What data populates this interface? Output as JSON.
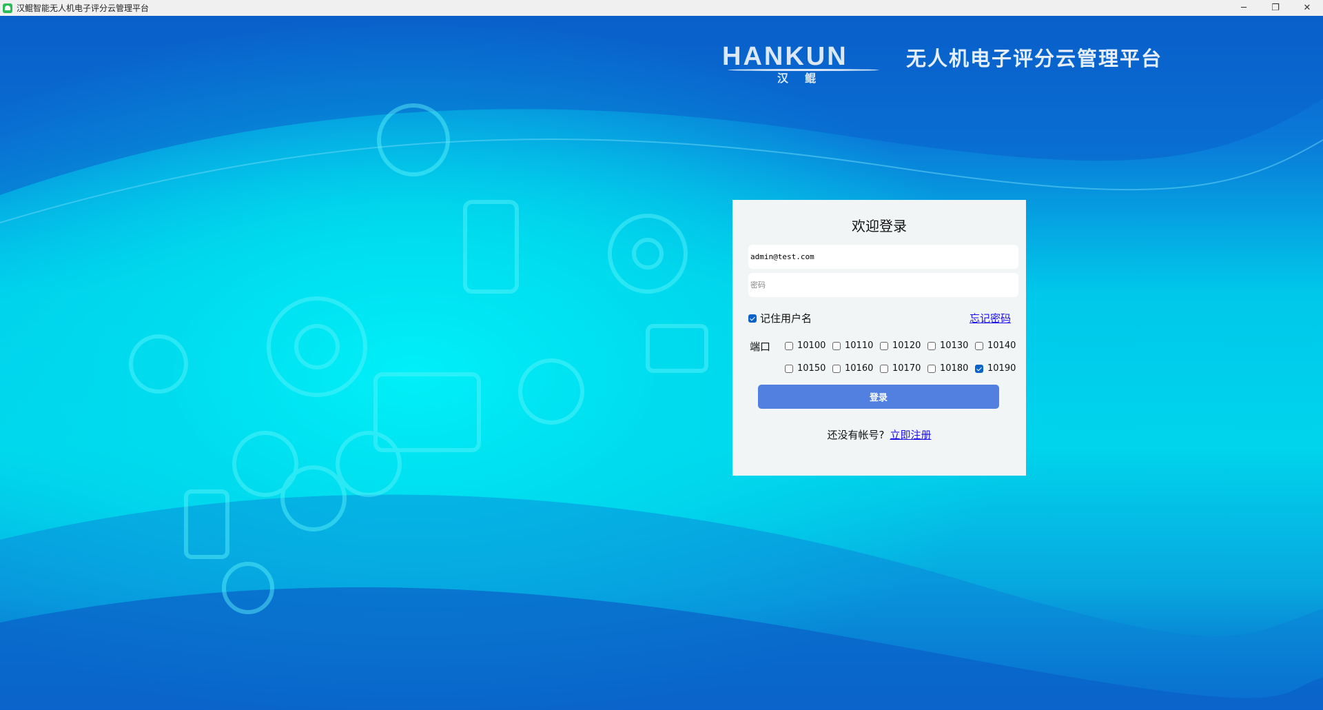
{
  "window": {
    "title": "汉鲲智能无人机电子评分云管理平台",
    "minimize": "─",
    "restore": "❐",
    "close": "✕"
  },
  "header": {
    "logo_en": "HANKUN",
    "logo_cn": "汉鲲",
    "title": "无人机电子评分云管理平台"
  },
  "login": {
    "heading": "欢迎登录",
    "email_value": "admin@test.com",
    "password_placeholder": "密码",
    "remember_label": "记住用户名",
    "remember_checked": true,
    "forgot_link": "忘记密码",
    "port_label": "端口",
    "ports": [
      {
        "v": "10100",
        "c": false
      },
      {
        "v": "10110",
        "c": false
      },
      {
        "v": "10120",
        "c": false
      },
      {
        "v": "10130",
        "c": false
      },
      {
        "v": "10140",
        "c": false
      },
      {
        "v": "10150",
        "c": false
      },
      {
        "v": "10160",
        "c": false
      },
      {
        "v": "10170",
        "c": false
      },
      {
        "v": "10180",
        "c": false
      },
      {
        "v": "10190",
        "c": true
      }
    ],
    "login_button": "登录",
    "no_account": "还没有帐号?",
    "register_link": "立即注册"
  }
}
